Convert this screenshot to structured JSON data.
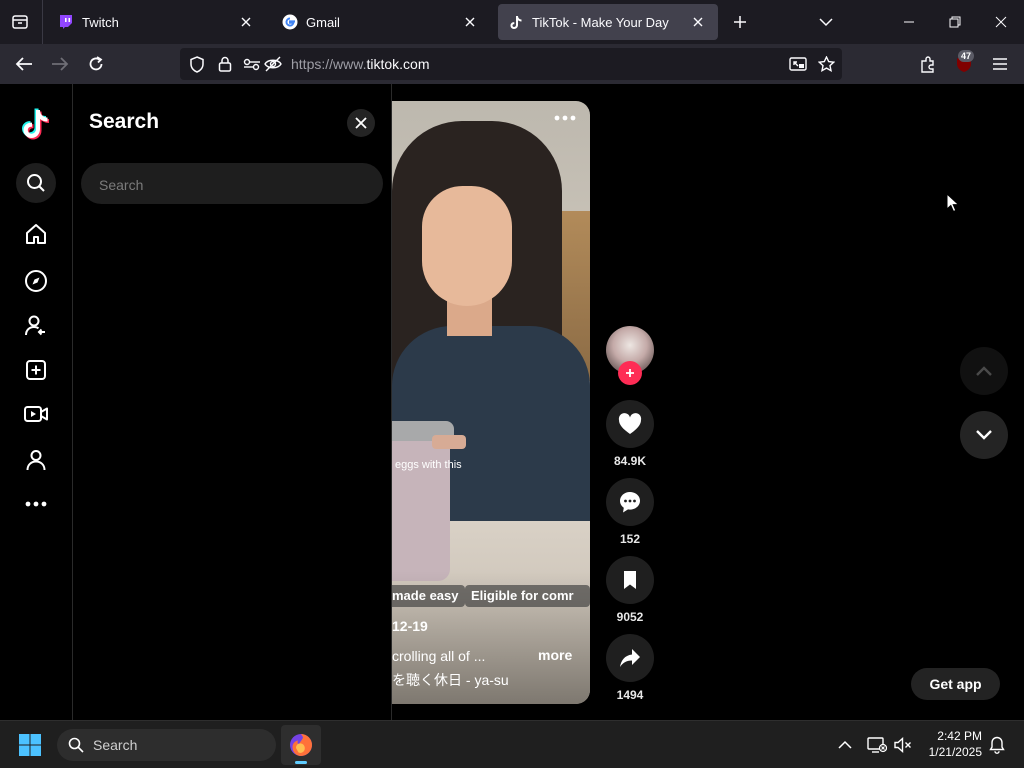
{
  "browser": {
    "tabs": [
      {
        "title": "Twitch",
        "favicon": "twitch-icon"
      },
      {
        "title": "Gmail",
        "favicon": "google-icon"
      },
      {
        "title": "TikTok - Make Your Day",
        "favicon": "tiktok-icon",
        "active": true
      }
    ],
    "url": {
      "prefix": "https://www.",
      "host": "tiktok.com"
    },
    "extension_badge": "47"
  },
  "sidebar": {
    "items": [
      "search-icon",
      "home-icon",
      "explore-icon",
      "following-icon",
      "upload-icon",
      "live-icon",
      "profile-icon",
      "more-icon"
    ]
  },
  "search_panel": {
    "title": "Search",
    "placeholder": "Search"
  },
  "video": {
    "caption_overlay": "eggs with this",
    "tags": [
      "made easy",
      "Eligible for comr"
    ],
    "date": "12-19",
    "description": "crolling all of ...",
    "more_label": "more",
    "music": "を聴く休日 - ya-su"
  },
  "actions": {
    "likes": "84.9K",
    "comments": "152",
    "saves": "9052",
    "shares": "1494"
  },
  "get_app_label": "Get app",
  "taskbar": {
    "search_label": "Search",
    "time": "2:42 PM",
    "date": "1/21/2025"
  },
  "colors": {
    "tiktok_red": "#fe2c55",
    "tiktok_cyan": "#25f4ee",
    "browser_tab_bg": "#1c1b22",
    "browser_nav_bg": "#2b2a33"
  }
}
